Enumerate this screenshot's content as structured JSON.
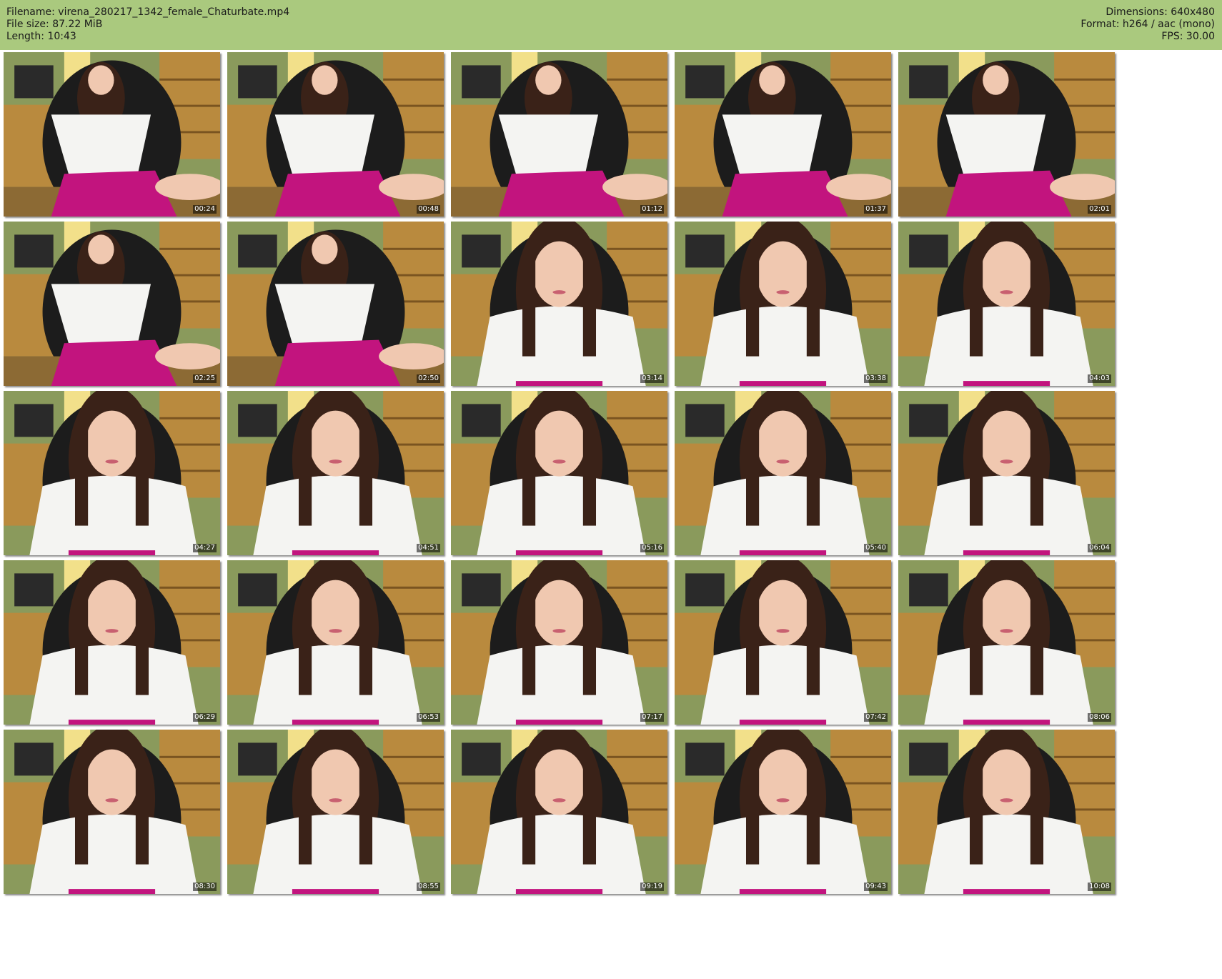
{
  "header": {
    "filename": "Filename: virena_280217_1342_female_Chaturbate.mp4",
    "filesize": "File size: 87.22 MiB",
    "length": "Length: 10:43",
    "dimensions": "Dimensions: 640x480",
    "format": "Format: h264 / aac (mono)",
    "fps": "FPS: 30.00"
  },
  "colors": {
    "header_bg": "#aac97e",
    "skirt": "#c2147e",
    "hair": "#3a2218",
    "shirt": "#f4f4f2",
    "wall": "#8a9a5c",
    "wood": "#b98a3e"
  },
  "thumbnails": [
    {
      "time": "00:24",
      "scene": "wide"
    },
    {
      "time": "00:48",
      "scene": "wide"
    },
    {
      "time": "01:12",
      "scene": "wide"
    },
    {
      "time": "01:37",
      "scene": "wide"
    },
    {
      "time": "02:01",
      "scene": "wide"
    },
    {
      "time": "02:25",
      "scene": "wide"
    },
    {
      "time": "02:50",
      "scene": "wide"
    },
    {
      "time": "03:14",
      "scene": "close"
    },
    {
      "time": "03:38",
      "scene": "close"
    },
    {
      "time": "04:03",
      "scene": "close"
    },
    {
      "time": "04:27",
      "scene": "close"
    },
    {
      "time": "04:51",
      "scene": "close"
    },
    {
      "time": "05:16",
      "scene": "close"
    },
    {
      "time": "05:40",
      "scene": "close"
    },
    {
      "time": "06:04",
      "scene": "close"
    },
    {
      "time": "06:29",
      "scene": "close"
    },
    {
      "time": "06:53",
      "scene": "close"
    },
    {
      "time": "07:17",
      "scene": "close"
    },
    {
      "time": "07:42",
      "scene": "close"
    },
    {
      "time": "08:06",
      "scene": "close"
    },
    {
      "time": "08:30",
      "scene": "close"
    },
    {
      "time": "08:55",
      "scene": "close"
    },
    {
      "time": "09:19",
      "scene": "close"
    },
    {
      "time": "09:43",
      "scene": "close"
    },
    {
      "time": "10:08",
      "scene": "close"
    }
  ]
}
